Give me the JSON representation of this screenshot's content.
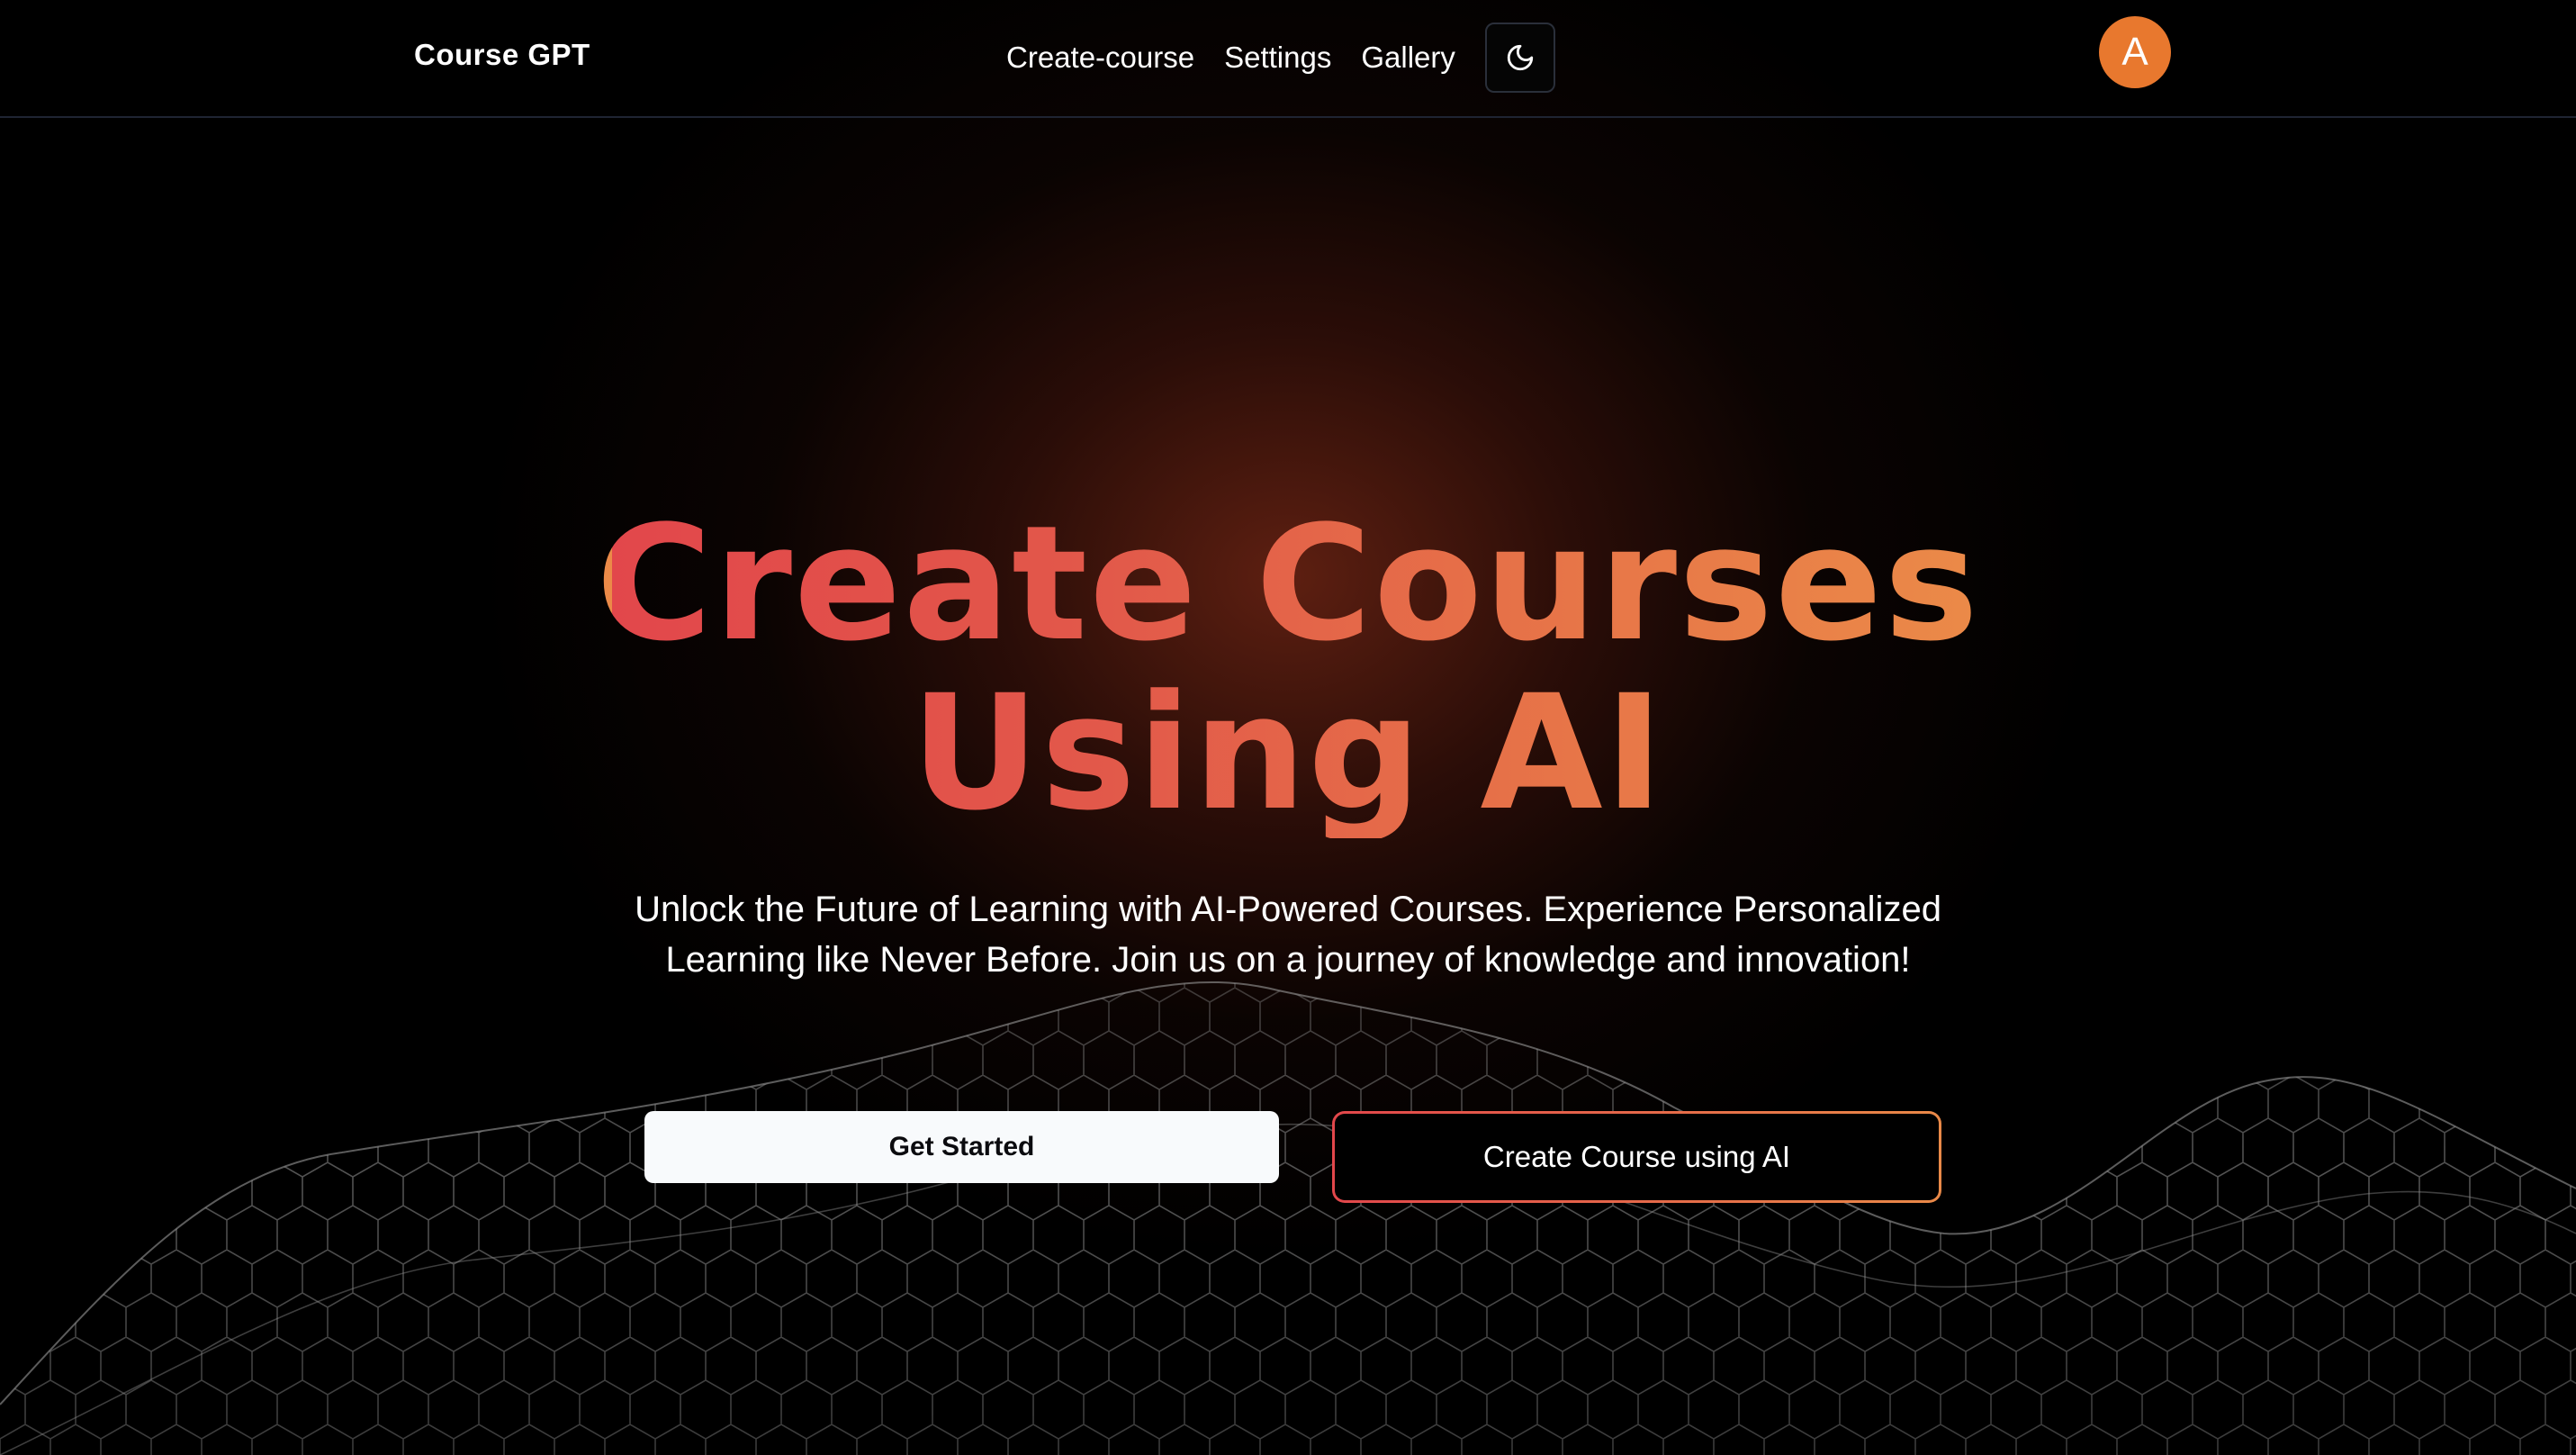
{
  "nav": {
    "brand": "Course GPT",
    "links": [
      "Create-course",
      "Settings",
      "Gallery"
    ],
    "theme_icon": "moon-icon",
    "avatar_initial": "A",
    "avatar_color": "#e8782e"
  },
  "hero": {
    "title_line1": "Create Courses",
    "title_line2": "Using AI",
    "subtitle_line1": "Unlock the Future of Learning with AI-Powered Courses. Experience Personalized",
    "subtitle_line2": "Learning like Never Before. Join us on a journey of knowledge and innovation!",
    "primary_button": "Get Started",
    "secondary_button": "Create Course using AI",
    "gradient_start": "#e2474b",
    "gradient_end": "#eb8a48"
  },
  "background": {
    "base_color": "#000000",
    "glow_color": "#782816",
    "decoration": "hexagon-mesh-wave"
  }
}
